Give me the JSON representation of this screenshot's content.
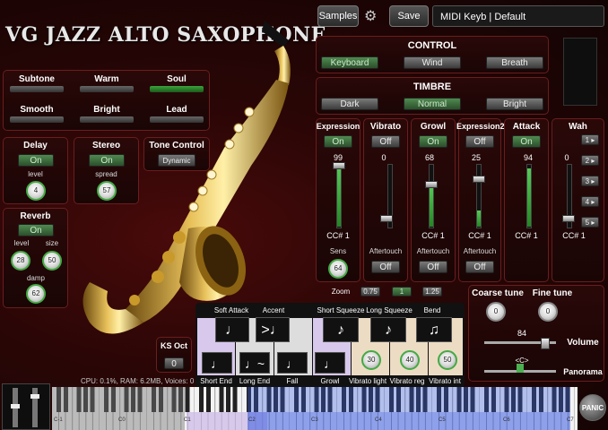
{
  "title": "VG JAZZ ALTO SAXOPHONE",
  "topbar": {
    "samples": "Samples",
    "save": "Save",
    "preset": "MIDI Keyb | Default"
  },
  "articulation_styles": [
    "Subtone",
    "Warm",
    "Soul",
    "Smooth",
    "Bright",
    "Lead"
  ],
  "delay": {
    "title": "Delay",
    "state": "On",
    "knob_label": "level",
    "level": "4"
  },
  "stereo": {
    "title": "Stereo",
    "state": "On",
    "knob_label": "spread",
    "spread": "57"
  },
  "tone": {
    "title": "Tone Control",
    "mode": "Dynamic"
  },
  "reverb": {
    "title": "Reverb",
    "state": "On",
    "level_label": "level",
    "size_label": "size",
    "damp_label": "damp",
    "level": "28",
    "size": "50",
    "damp": "62"
  },
  "control": {
    "title": "CONTROL",
    "options": [
      "Keyboard",
      "Wind",
      "Breath"
    ],
    "selected": "Keyboard"
  },
  "timbre": {
    "title": "TIMBRE",
    "options": [
      "Dark",
      "Normal",
      "Bright"
    ],
    "selected": "Normal"
  },
  "channels": [
    {
      "title": "Expression",
      "state": "On",
      "value": "99",
      "cc": "CC# 1",
      "sens_label": "Sens",
      "sens": "64",
      "level": 0.99
    },
    {
      "title": "Vibrato",
      "state": "Off",
      "value": "0",
      "aftertouch": "Aftertouch",
      "at_state": "Off",
      "level": 0.0
    },
    {
      "title": "Growl",
      "state": "On",
      "value": "68",
      "cc": "CC# 1",
      "aftertouch": "Aftertouch",
      "at_state": "Off",
      "level": 0.68
    },
    {
      "title": "Expression2",
      "state": "Off",
      "value": "25",
      "cc": "CC# 1",
      "aftertouch": "Aftertouch",
      "at_state": "Off",
      "level": 0.25
    },
    {
      "title": "Attack",
      "state": "On",
      "value": "94",
      "cc": "CC# 1",
      "level": 0.94
    }
  ],
  "wah": {
    "title": "Wah",
    "value": "0",
    "cc": "CC# 1",
    "steps": [
      "1",
      "2",
      "3",
      "4",
      "5"
    ]
  },
  "zoom": {
    "label": "Zoom",
    "options": [
      "0.75",
      "1",
      "1.25"
    ],
    "selected": "1"
  },
  "articulations_top": [
    "Soft Attack",
    "Accent",
    "Short Squeeze",
    "Long Squeeze",
    "Bend"
  ],
  "articulations_bottom": [
    "Short End",
    "Long End",
    "Fall",
    "Growl",
    "Vibrato light",
    "Vibrato reg",
    "Vibrato int"
  ],
  "vibrato_values": [
    "30",
    "40",
    "50"
  ],
  "ks_oct": {
    "label": "KS Oct",
    "value": "0"
  },
  "tuning": {
    "coarse_label": "Coarse tune",
    "fine_label": "Fine tune",
    "coarse": "0",
    "fine": "0",
    "volume_label": "Volume",
    "volume": "84",
    "panorama_label": "Panorama",
    "pan": "<C>"
  },
  "status": "CPU: 0.1%, RAM: 6.2MB, Voices: 0",
  "keyboard": {
    "octave_labels": [
      "C-1",
      "C0",
      "C1",
      "C2",
      "C3",
      "C4",
      "C5",
      "C6",
      "C7"
    ],
    "panic": "PANIC"
  },
  "colors": {
    "accent_green": "#4caf50",
    "panel_border": "#6a1d1d",
    "background": "#2a0606"
  }
}
